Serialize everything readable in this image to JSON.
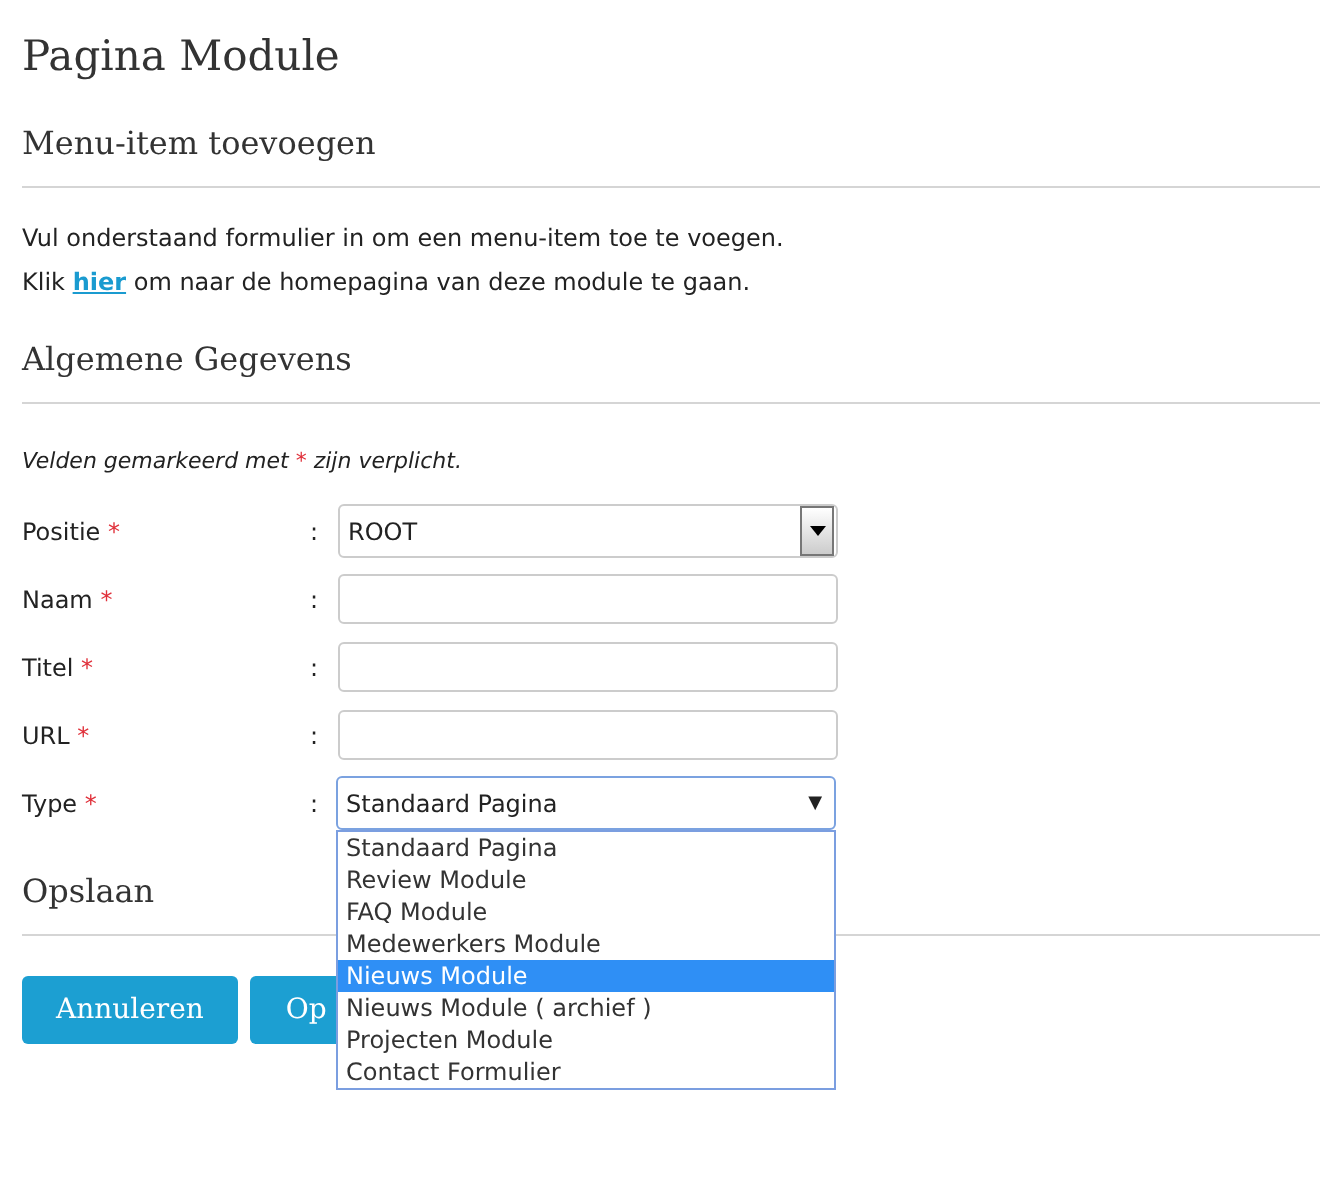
{
  "page_title": "Pagina Module",
  "sections": [
    {
      "heading": "Menu-item toevoegen"
    },
    {
      "heading": "Algemene Gegevens"
    },
    {
      "heading": "Opslaan"
    }
  ],
  "intro": "Vul onderstaand formulier in om een menu-item toe te voegen.",
  "link_line": {
    "before": "Klik",
    "link": "hier",
    "after": "om naar de homepagina van deze module te gaan."
  },
  "required_note": {
    "before": "Velden gemarkeerd met",
    "mark": "*",
    "after": "zijn verplicht."
  },
  "fields": [
    {
      "label": "Positie",
      "required": "*",
      "colon": ":",
      "kind": "select",
      "value": "ROOT"
    },
    {
      "label": "Naam",
      "required": "*",
      "colon": ":",
      "kind": "text"
    },
    {
      "label": "Titel",
      "required": "*",
      "colon": ":",
      "kind": "text"
    },
    {
      "label": "URL",
      "required": "*",
      "colon": ":",
      "kind": "text"
    },
    {
      "label": "Type",
      "required": "*",
      "colon": ":",
      "kind": "dropdown",
      "value": "Standaard Pagina",
      "arrow": "▼",
      "expanded": true,
      "options": [
        {
          "label": "Standaard Pagina",
          "highlighted": false
        },
        {
          "label": "Review Module",
          "highlighted": false
        },
        {
          "label": "FAQ Module",
          "highlighted": false
        },
        {
          "label": "Medewerkers Module",
          "highlighted": false
        },
        {
          "label": "Nieuws Module",
          "highlighted": true
        },
        {
          "label": "Nieuws Module ( archief )",
          "highlighted": false
        },
        {
          "label": "Projecten Module",
          "highlighted": false
        },
        {
          "label": "Contact Formulier",
          "highlighted": false
        }
      ]
    }
  ],
  "buttons": [
    {
      "label": "Annuleren"
    },
    {
      "label": "Op"
    }
  ]
}
